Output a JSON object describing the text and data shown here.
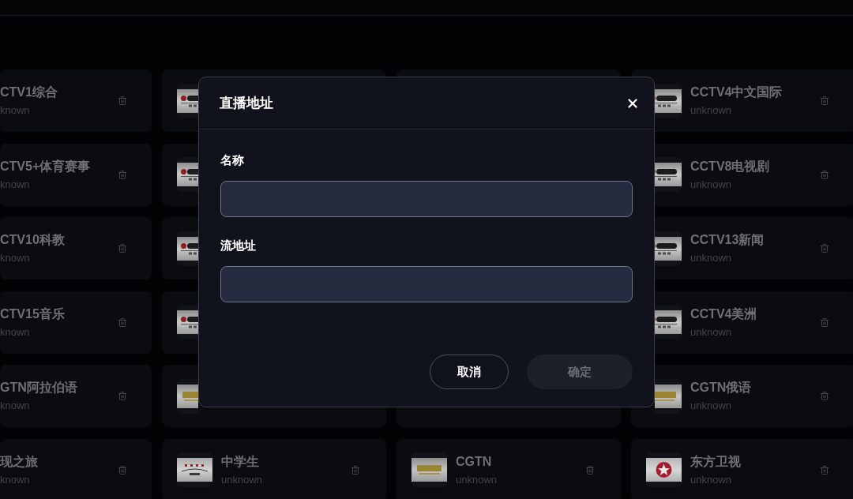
{
  "columns": [
    [
      {
        "name": "CTV1综合",
        "status": "known"
      },
      {
        "name": "CTV5+体育赛事",
        "status": "known"
      },
      {
        "name": "CTV10科教",
        "status": "known"
      },
      {
        "name": "CTV15音乐",
        "status": "known"
      },
      {
        "name": "GTN阿拉伯语",
        "status": "known"
      },
      {
        "name": "现之旅",
        "status": "known"
      }
    ],
    [
      {
        "kind": "cctv"
      },
      {
        "kind": "cctv"
      },
      {
        "kind": "cctv"
      },
      {
        "kind": "cctv"
      },
      {
        "kind": "cgtn"
      },
      {
        "kind": "school",
        "name": "中学生",
        "status": "unknown"
      }
    ],
    [
      {
        "kind": "cgtn",
        "name": "CGTN",
        "status": "unknown"
      }
    ],
    [
      {
        "kind": "cctv",
        "name": "CCTV4中文国际",
        "status": "unknown"
      },
      {
        "kind": "cctv",
        "name": "CCTV8电视剧",
        "status": "unknown"
      },
      {
        "kind": "cctv",
        "name": "CCTV13新闻",
        "status": "unknown"
      },
      {
        "kind": "cctv",
        "name": "CCTV4美洲",
        "status": "unknown"
      },
      {
        "kind": "cgtn",
        "name": "CGTN俄语",
        "status": "unknown"
      },
      {
        "kind": "star",
        "name": "东方卫视",
        "status": "unknown"
      }
    ]
  ],
  "dialog": {
    "title": "直播地址",
    "fields": [
      {
        "label": "名称"
      },
      {
        "label": "流地址"
      }
    ],
    "buttons": [
      {
        "label": "取消",
        "kind": "secondary",
        "disabled": false
      },
      {
        "label": "确定",
        "kind": "primary",
        "disabled": true
      }
    ]
  }
}
